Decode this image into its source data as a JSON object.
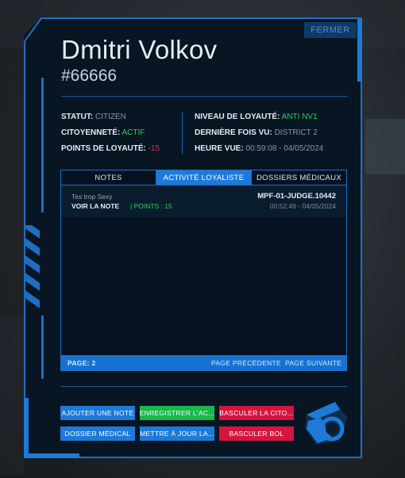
{
  "window": {
    "close_label": "FERMER"
  },
  "profile": {
    "name": "Dmitri Volkov",
    "cid": "#66666"
  },
  "info_left": [
    {
      "key": "STATUT:",
      "value": "CITIZEN",
      "tone": "gray"
    },
    {
      "key": "CITOYENNETÉ:",
      "value": "ACTIF",
      "tone": "green"
    },
    {
      "key": "POINTS DE LOYAUTÉ:",
      "value": "-15",
      "tone": "red"
    }
  ],
  "info_right": [
    {
      "key": "NIVEAU DE LOYAUTÉ:",
      "value": "ANTI NV1",
      "tone": "green"
    },
    {
      "key": "DERNIÈRE FOIS VU:",
      "value": "DISTRICT 2",
      "tone": "gray"
    },
    {
      "key": "HEURE VUE:",
      "value": "00:59:08 - 04/05/2024",
      "tone": "gray"
    }
  ],
  "tabs": [
    {
      "label": "NOTES",
      "active": false
    },
    {
      "label": "ACTIVITÉ LOYALISTE",
      "active": true
    },
    {
      "label": "DOSSIERS MÉDICAUX",
      "active": false
    }
  ],
  "entries": [
    {
      "author": "Tes trop Sexy",
      "view_label": "VOIR LA NOTE",
      "points": "| POINTS : 15",
      "officer": "MPF-01-JUDGE.10442",
      "time": "00:52:49 - 04/05/2024"
    }
  ],
  "pager": {
    "page": "PAGE: 2",
    "prev": "PAGE PRÉCÉDENTE",
    "next": "PAGE SUIVANTE"
  },
  "actions": {
    "row1": [
      {
        "label": "AJOUTER UNE NOTE",
        "color": "blue"
      },
      {
        "label": "ENREGISTRER L'AC...",
        "color": "green"
      },
      {
        "label": "BASCULER LA CITO...",
        "color": "red"
      }
    ],
    "row2": [
      {
        "label": "DOSSIER MÉDICAL",
        "color": "blue"
      },
      {
        "label": "METTRE À JOUR LA...",
        "color": "blue"
      },
      {
        "label": "BASCULER BOL",
        "color": "red"
      }
    ]
  },
  "colors": {
    "accent": "#1e7ad8",
    "green": "#2fd35a",
    "red": "#e0334f",
    "background": "#081523"
  },
  "logo_icon": "lambda-logo-icon"
}
